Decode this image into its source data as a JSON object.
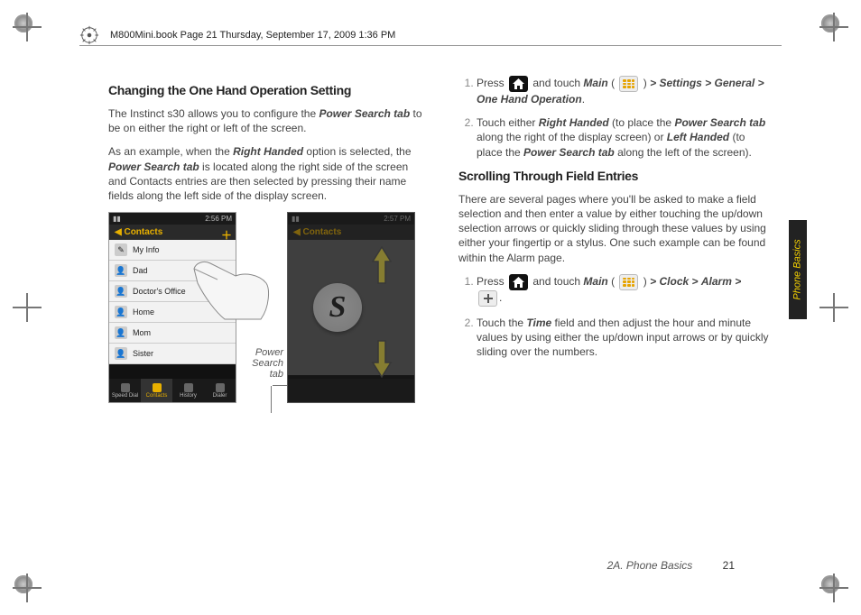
{
  "header": {
    "runningHead": "M800Mini.book  Page 21  Thursday, September 17, 2009  1:36 PM"
  },
  "sideTab": {
    "label": "Phone Basics"
  },
  "footer": {
    "section": "2A. Phone Basics",
    "pageNum": "21"
  },
  "left": {
    "heading": "Changing the One Hand Operation Setting",
    "p1a": "The Instinct s30 allows you to configure the ",
    "p1b": "Power Search tab",
    "p1c": " to be on either the right or left of the screen.",
    "p2a": "As an example, when the ",
    "p2b": "Right Handed",
    "p2c": " option is selected, the ",
    "p2d": "Power Search tab",
    "p2e": " is located along the right side of the screen and Contacts entries are then selected by pressing their name fields along the left side of the display screen.",
    "figureLabel": "Power Search tab",
    "phone": {
      "time": "2:56 PM",
      "time2": "2:57 PM",
      "title": "Contacts",
      "items": [
        "My Info",
        "Dad",
        "Doctor's Office",
        "Home",
        "Mom",
        "Sister"
      ],
      "tabs": [
        "Speed Dial",
        "Contacts",
        "History",
        "Dialer"
      ]
    }
  },
  "right": {
    "step1": {
      "a": "Press ",
      "b": " and touch ",
      "mainWord": "Main",
      "c": " (",
      "d": ") ",
      "sep": ">",
      "settings": "Settings",
      "general": "General",
      "oneHand": "One Hand Operation",
      "period": "."
    },
    "step2": {
      "a": "Touch either ",
      "rh": "Right Handed",
      "b": " (to place the ",
      "pst": "Power Search tab",
      "c": " along the right of the display screen) or ",
      "lh": "Left Handed",
      "d": " (to place the ",
      "e": " along the left of the screen)."
    },
    "heading2": "Scrolling Through Field Entries",
    "p3": "There are several pages where you'll be asked to make a field selection and then enter a value by either touching the up/down selection arrows or quickly sliding through these values by using either your fingertip or a stylus. One such example can be found within the Alarm page.",
    "step3": {
      "a": "Press ",
      "b": " and touch ",
      "mainWord": "Main",
      "c": " (",
      "d": ") ",
      "sep": ">",
      "clock": "Clock",
      "alarm": "Alarm",
      "period": "."
    },
    "step4": {
      "a": "Touch the ",
      "time": "Time",
      "b": " field and then adjust the hour and minute values by using either the up/down input arrows or by quickly sliding over the numbers."
    }
  }
}
